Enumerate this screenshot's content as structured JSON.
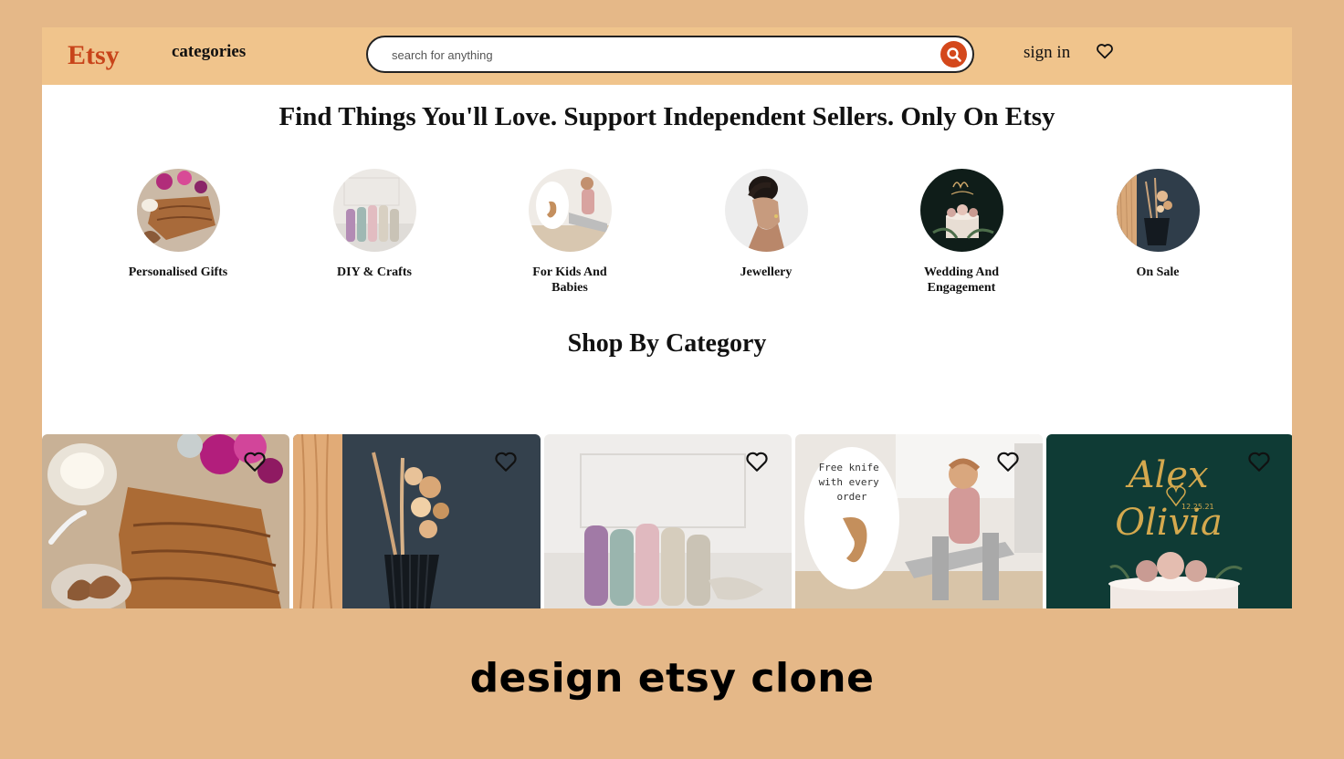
{
  "nav": {
    "logo": "Etsy",
    "categories_label": "categories",
    "search_placeholder": "search for anything",
    "signin_label": "sign in",
    "icons": [
      "search-icon",
      "heart-icon"
    ]
  },
  "hero": {
    "headline": "Find Things You'll Love. Support Independent Sellers. Only On Etsy"
  },
  "categories": [
    {
      "label": "Personalised Gifts"
    },
    {
      "label": "DIY & Crafts"
    },
    {
      "label": "For Kids And Babies"
    },
    {
      "label": "Jewellery"
    },
    {
      "label": "Wedding And Engagement"
    },
    {
      "label": "On Sale"
    }
  ],
  "shop": {
    "title": "Shop By Category",
    "card_image_texts": {
      "kids_sign": "Free knife\nwith every\norder",
      "wedding_names": "Alex\nOlivia",
      "wedding_date": "12.25.21"
    }
  },
  "caption": "design etsy clone",
  "colors": {
    "background": "#e5b888",
    "navbar": "#f0c48c",
    "logo": "#c8441a",
    "search_button": "#d4481c"
  }
}
